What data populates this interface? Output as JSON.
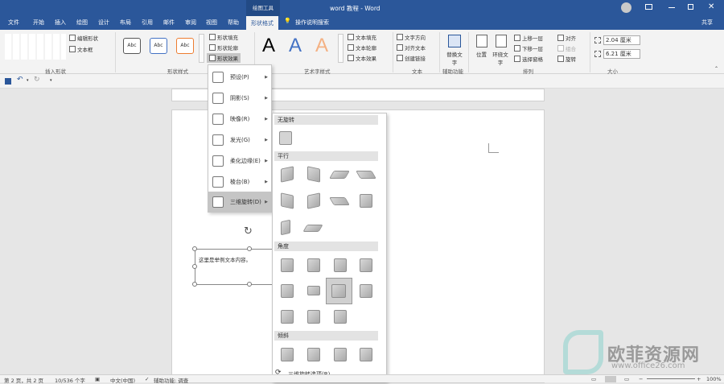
{
  "titlebar": {
    "context_tool": "绘图工具",
    "title": "word 教程 - Word",
    "share_label": "共享"
  },
  "tabs": [
    "文件",
    "开始",
    "插入",
    "绘图",
    "设计",
    "布局",
    "引用",
    "邮件",
    "审阅",
    "视图",
    "帮助",
    "形状格式",
    "操作说明搜索"
  ],
  "ribbon": {
    "insert_shapes": {
      "edit_shape": "编辑形状",
      "text_box": "文本框",
      "group": "插入形状"
    },
    "shape_styles": {
      "sample": "Abc",
      "fill": "形状填充",
      "outline": "形状轮廓",
      "effects": "形状效果",
      "group": "形状样式"
    },
    "wordart": {
      "letter": "A",
      "fill": "文本填充",
      "outline": "文本轮廓",
      "effects": "文本效果",
      "group": "艺术字样式"
    },
    "text": {
      "direction": "文字方向",
      "align": "对齐文本",
      "link": "创建链接",
      "group": "文本"
    },
    "accessibility": {
      "alt_text": "替换文字",
      "group": "辅助功能"
    },
    "arrange": {
      "position": "位置",
      "wrap": "环绕文字",
      "forward": "上移一层",
      "backward": "下移一层",
      "selection": "选择窗格",
      "align": "对齐",
      "group_btn": "组合",
      "rotate": "旋转",
      "group": "排列"
    },
    "size": {
      "height": "2.04 厘米",
      "width": "6.21 厘米",
      "group": "大小"
    }
  },
  "effects_menu": [
    "预设(P)",
    "阴影(S)",
    "映像(R)",
    "发光(G)",
    "柔化边缘(E)",
    "棱台(B)",
    "三维旋转(D)"
  ],
  "gallery": {
    "none": "无旋转",
    "parallel": "平行",
    "perspective": "角度",
    "oblique": "倾斜",
    "options": "三维旋转选项(R)..."
  },
  "document": {
    "textbox_text": "这里是举例文本内容。"
  },
  "status": {
    "page": "第 2 页，共 2 页",
    "words": "10/536 个字",
    "lang": "中文(中国)",
    "accessibility": "辅助功能: 调查",
    "zoom": "100%"
  },
  "watermark": {
    "brand": "欧菲资源网",
    "url": "www.office26.com"
  },
  "colors": {
    "word_blue": "#2b579a",
    "active_tab_bg": "#ffffff",
    "hover": "#c5c5c5"
  }
}
